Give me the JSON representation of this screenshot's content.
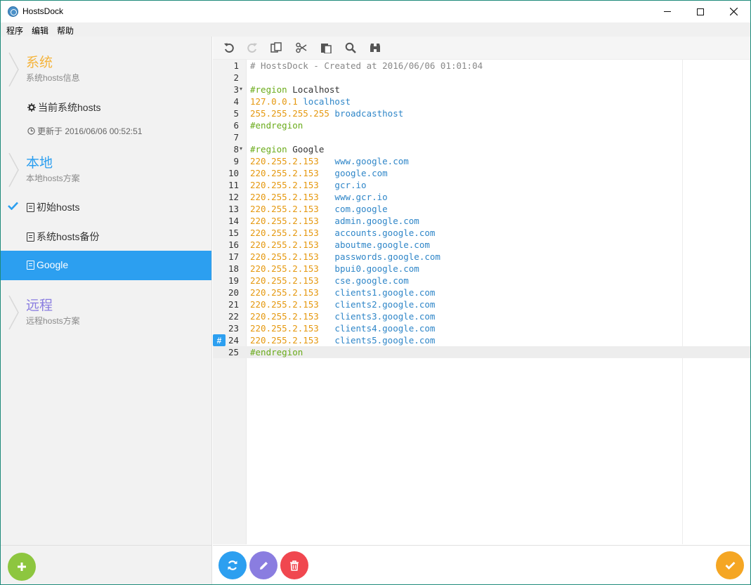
{
  "window": {
    "title": "HostsDock"
  },
  "menu": [
    "程序",
    "编辑",
    "帮助"
  ],
  "sidebar": {
    "system": {
      "title": "系统",
      "subtitle": "系统hosts信息",
      "color": "#f5b43c"
    },
    "current_hosts_label": "当前系统hosts",
    "updated_label": "更新于 2016/06/06 00:52:51",
    "local": {
      "title": "本地",
      "subtitle": "本地hosts方案",
      "color": "#2c9ff0"
    },
    "local_items": [
      {
        "label": "初始hosts",
        "checked": true,
        "active": false
      },
      {
        "label": "系统hosts备份",
        "checked": false,
        "active": false
      },
      {
        "label": "Google",
        "checked": false,
        "active": true
      }
    ],
    "remote": {
      "title": "远程",
      "subtitle": "远程hosts方案",
      "color": "#8a7de0"
    }
  },
  "toolbar": [
    "undo-icon",
    "redo-icon",
    "copy-icon",
    "cut-icon",
    "paste-icon",
    "search-icon",
    "find-replace-icon"
  ],
  "editor": {
    "active_line": 25,
    "marker_line": 24,
    "lines": [
      {
        "n": "1",
        "parts": [
          {
            "t": "# HostsDock - Created at 2016/06/06 01:01:04",
            "c": "comment"
          }
        ]
      },
      {
        "n": "2",
        "parts": []
      },
      {
        "n": "3",
        "fold": true,
        "parts": [
          {
            "t": "#region",
            "c": "keyword"
          },
          {
            "t": " Localhost",
            "c": "plain"
          }
        ]
      },
      {
        "n": "4",
        "parts": [
          {
            "t": "127.0.0.1",
            "c": "ip"
          },
          {
            "t": " ",
            "c": "plain"
          },
          {
            "t": "localhost",
            "c": "host"
          }
        ]
      },
      {
        "n": "5",
        "parts": [
          {
            "t": "255.255.255.255",
            "c": "ip"
          },
          {
            "t": " ",
            "c": "plain"
          },
          {
            "t": "broadcasthost",
            "c": "host"
          }
        ]
      },
      {
        "n": "6",
        "parts": [
          {
            "t": "#endregion",
            "c": "keyword"
          }
        ]
      },
      {
        "n": "7",
        "parts": []
      },
      {
        "n": "8",
        "fold": true,
        "parts": [
          {
            "t": "#region",
            "c": "keyword"
          },
          {
            "t": " Google",
            "c": "plain"
          }
        ]
      },
      {
        "n": "9",
        "parts": [
          {
            "t": "220.255.2.153",
            "c": "ip"
          },
          {
            "t": "   ",
            "c": "plain"
          },
          {
            "t": "www.google.com",
            "c": "host"
          }
        ]
      },
      {
        "n": "10",
        "parts": [
          {
            "t": "220.255.2.153",
            "c": "ip"
          },
          {
            "t": "   ",
            "c": "plain"
          },
          {
            "t": "google.com",
            "c": "host"
          }
        ]
      },
      {
        "n": "11",
        "parts": [
          {
            "t": "220.255.2.153",
            "c": "ip"
          },
          {
            "t": "   ",
            "c": "plain"
          },
          {
            "t": "gcr.io",
            "c": "host"
          }
        ]
      },
      {
        "n": "12",
        "parts": [
          {
            "t": "220.255.2.153",
            "c": "ip"
          },
          {
            "t": "   ",
            "c": "plain"
          },
          {
            "t": "www.gcr.io",
            "c": "host"
          }
        ]
      },
      {
        "n": "13",
        "parts": [
          {
            "t": "220.255.2.153",
            "c": "ip"
          },
          {
            "t": "   ",
            "c": "plain"
          },
          {
            "t": "com.google",
            "c": "host"
          }
        ]
      },
      {
        "n": "14",
        "parts": [
          {
            "t": "220.255.2.153",
            "c": "ip"
          },
          {
            "t": "   ",
            "c": "plain"
          },
          {
            "t": "admin.google.com",
            "c": "host"
          }
        ]
      },
      {
        "n": "15",
        "parts": [
          {
            "t": "220.255.2.153",
            "c": "ip"
          },
          {
            "t": "   ",
            "c": "plain"
          },
          {
            "t": "accounts.google.com",
            "c": "host"
          }
        ]
      },
      {
        "n": "16",
        "parts": [
          {
            "t": "220.255.2.153",
            "c": "ip"
          },
          {
            "t": "   ",
            "c": "plain"
          },
          {
            "t": "aboutme.google.com",
            "c": "host"
          }
        ]
      },
      {
        "n": "17",
        "parts": [
          {
            "t": "220.255.2.153",
            "c": "ip"
          },
          {
            "t": "   ",
            "c": "plain"
          },
          {
            "t": "passwords.google.com",
            "c": "host"
          }
        ]
      },
      {
        "n": "18",
        "parts": [
          {
            "t": "220.255.2.153",
            "c": "ip"
          },
          {
            "t": "   ",
            "c": "plain"
          },
          {
            "t": "bpui0.google.com",
            "c": "host"
          }
        ]
      },
      {
        "n": "19",
        "parts": [
          {
            "t": "220.255.2.153",
            "c": "ip"
          },
          {
            "t": "   ",
            "c": "plain"
          },
          {
            "t": "cse.google.com",
            "c": "host"
          }
        ]
      },
      {
        "n": "20",
        "parts": [
          {
            "t": "220.255.2.153",
            "c": "ip"
          },
          {
            "t": "   ",
            "c": "plain"
          },
          {
            "t": "clients1.google.com",
            "c": "host"
          }
        ]
      },
      {
        "n": "21",
        "parts": [
          {
            "t": "220.255.2.153",
            "c": "ip"
          },
          {
            "t": "   ",
            "c": "plain"
          },
          {
            "t": "clients2.google.com",
            "c": "host"
          }
        ]
      },
      {
        "n": "22",
        "parts": [
          {
            "t": "220.255.2.153",
            "c": "ip"
          },
          {
            "t": "   ",
            "c": "plain"
          },
          {
            "t": "clients3.google.com",
            "c": "host"
          }
        ]
      },
      {
        "n": "23",
        "parts": [
          {
            "t": "220.255.2.153",
            "c": "ip"
          },
          {
            "t": "   ",
            "c": "plain"
          },
          {
            "t": "clients4.google.com",
            "c": "host"
          }
        ]
      },
      {
        "n": "24",
        "parts": [
          {
            "t": "220.255.2.153",
            "c": "ip"
          },
          {
            "t": "   ",
            "c": "plain"
          },
          {
            "t": "clients5.google.com",
            "c": "host"
          }
        ]
      },
      {
        "n": "25",
        "parts": [
          {
            "t": "#endregion",
            "c": "keyword"
          }
        ]
      }
    ]
  },
  "buttons": {
    "add": {
      "icon": "plus-icon",
      "color": "#8dc63f"
    },
    "refresh": {
      "icon": "refresh-icon",
      "color": "#2c9ff0"
    },
    "edit": {
      "icon": "pencil-icon",
      "color": "#8a7de0"
    },
    "delete": {
      "icon": "trash-icon",
      "color": "#f0474f"
    },
    "apply": {
      "icon": "check-icon",
      "color": "#f5a623"
    }
  }
}
